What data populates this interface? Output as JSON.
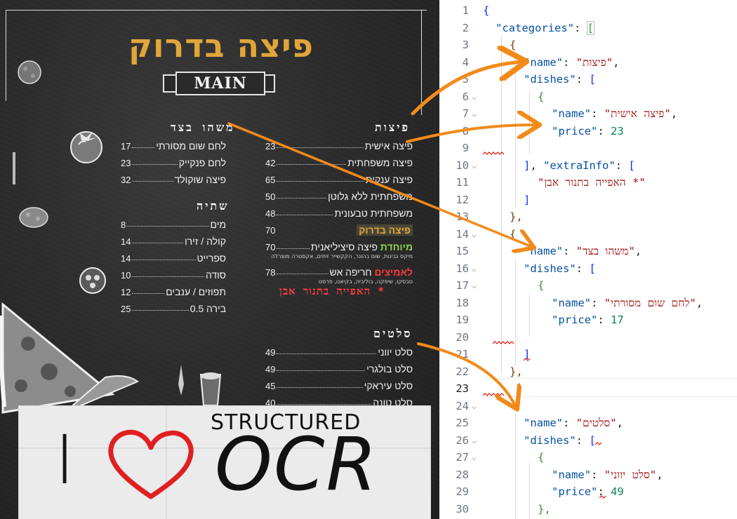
{
  "menu": {
    "restaurant_name": "פיצה בדרוק",
    "banner_label": "MAIN",
    "sections": {
      "pizzas": {
        "title": "פיצות",
        "items": [
          {
            "name": "פיצה אישית",
            "price": "23"
          },
          {
            "name": "פיצה משפחתית",
            "price": "42"
          },
          {
            "name": "פיצה ענקית",
            "price": "65"
          },
          {
            "name": "משפחתית ללא גלוטן",
            "price": "50"
          },
          {
            "name": "משפחתית טבעונית",
            "price": "48"
          }
        ],
        "special_title": "פיצה בדרוק",
        "special_price": "70",
        "item6_prefix": "מיוחדת",
        "item6_name": "פיצה סיציליאנית",
        "item6_price": "70",
        "item6_desc": "מיקס גבינות, שום בהונר, הקקשייר זיתים, אקסטרה מוצרלה",
        "item7_prefix": "לאמיצים",
        "item7_name": "חריפה אש",
        "item7_price": "78",
        "item7_desc": "טבסקו, שיפקה, בוליביה, בקיאנו, פרסנו",
        "note": "* האפייה בתנור אבן"
      },
      "nibbles": {
        "title": "משהו בצד",
        "items": [
          {
            "name": "לחם שום מסורתי",
            "price": "17"
          },
          {
            "name": "לחם פנקייק",
            "price": "23"
          },
          {
            "name": "פיצה שוקולד",
            "price": "32"
          }
        ]
      },
      "drinks": {
        "title": "שתיה",
        "items": [
          {
            "name": "מים",
            "price": "8"
          },
          {
            "name": "קולה / זירו",
            "price": "14"
          },
          {
            "name": "ספרייט",
            "price": "14"
          },
          {
            "name": "סודה",
            "price": "10"
          },
          {
            "name": "תפוזים / ענבים",
            "price": "12"
          },
          {
            "name": "בירה 0.5",
            "price": "25"
          }
        ]
      },
      "salads": {
        "title": "סלטים",
        "items": [
          {
            "name": "סלט יווני",
            "price": "49"
          },
          {
            "name": "סלט בולגרי",
            "price": "49"
          },
          {
            "name": "סלט עיראקי",
            "price": "45"
          },
          {
            "name": "סלט טונה",
            "price": "40"
          }
        ]
      }
    },
    "sticker": {
      "i_text": "I",
      "structured_text": "STRUCTURED",
      "ocr_text": "OCR"
    }
  },
  "editor": {
    "line_numbers": [
      "1",
      "2",
      "3",
      "4",
      "5",
      "6",
      "7",
      "8",
      "9",
      "10",
      "11",
      "12",
      "13",
      "14",
      "15",
      "16",
      "17",
      "18",
      "19",
      "20",
      "21",
      "22",
      "23",
      "24",
      "25",
      "26",
      "27",
      "28",
      "29",
      "30"
    ],
    "tokens": {
      "open_brace": "{",
      "close_brace": "}",
      "open_bracket": "[",
      "close_bracket": "]",
      "colon": ": ",
      "comma": ",",
      "key_categories": "\"categories\"",
      "key_name": "\"name\"",
      "key_dishes": "\"dishes\"",
      "key_price": "\"price\"",
      "key_extra": "\"extraInfo\"",
      "val_pizzas": "\"פיצות\"",
      "val_personal_pizza": "\"פיצה אישית\"",
      "val_23": "23",
      "val_extra": "\"האפייה בתנור אבן *\"",
      "val_side": "\"משהו בצד\"",
      "val_garlic_bread": "\"לחם שום מסורתי\"",
      "val_17": "17",
      "val_salads": "\"סלטים\"",
      "val_greek_salad": "\"סלט יווני\"",
      "val_49": "49",
      "closer_bracket_comma": "],",
      "closer_brace_comma": "},"
    }
  },
  "colors": {
    "menu_accent": "#e0a63b",
    "arrow": "#f28a1a",
    "heart": "#e02020",
    "json_key": "#0451a5",
    "json_string": "#a31515",
    "json_number": "#098658"
  }
}
